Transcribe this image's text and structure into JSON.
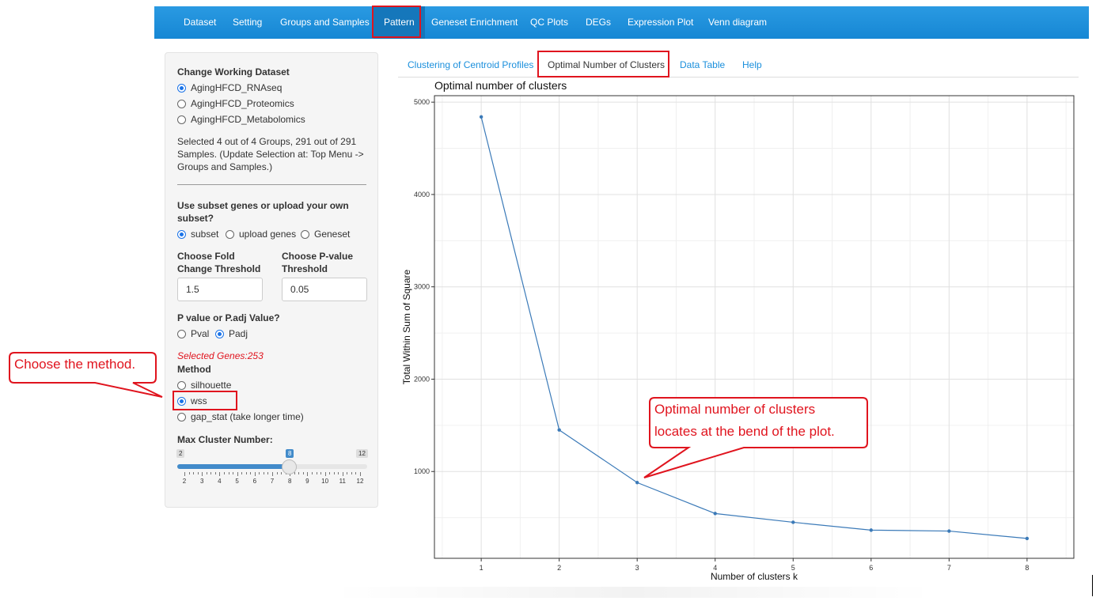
{
  "nav": {
    "items": [
      "Dataset",
      "Setting",
      "Groups and Samples",
      "Pattern",
      "Geneset Enrichment",
      "QC Plots",
      "DEGs",
      "Expression Plot",
      "Venn diagram"
    ],
    "active": "Pattern",
    "bg_color": "#1687d4"
  },
  "sidebar": {
    "dataset_heading": "Change Working Dataset",
    "datasets": [
      "AgingHFCD_RNAseq",
      "AgingHFCD_Proteomics",
      "AgingHFCD_Metabolomics"
    ],
    "dataset_selected": "AgingHFCD_RNAseq",
    "selection_info": [
      "Selected 4 out of 4 Groups, 291 out of 291",
      "Samples. (Update Selection at: Top Menu ->",
      "Groups and Samples.)"
    ],
    "subset_heading": [
      "Use subset genes or upload your own",
      "subset?"
    ],
    "subset_options": [
      "subset",
      "upload genes",
      "Geneset"
    ],
    "subset_selected": "subset",
    "fc_label": [
      "Choose Fold",
      "Change Threshold"
    ],
    "fc_value": "1.5",
    "p_label": [
      "Choose P-value",
      "Threshold"
    ],
    "p_value": "0.05",
    "pval_heading": "P value or P.adj Value?",
    "pval_options": [
      "Pval",
      "Padj"
    ],
    "pval_selected": "Padj",
    "selected_genes": "Selected Genes:253",
    "method_heading": "Method",
    "methods": [
      "silhouette",
      "wss",
      "gap_stat (take longer time)"
    ],
    "method_selected": "wss",
    "max_cluster_heading": "Max Cluster Number:",
    "slider": {
      "min": 2,
      "max": 12,
      "value": 8,
      "min_label": "2",
      "max_label": "12",
      "value_label": "8",
      "tick_labels": [
        "2",
        "3",
        "4",
        "5",
        "6",
        "7",
        "8",
        "9",
        "10",
        "11",
        "12"
      ]
    }
  },
  "tabs": {
    "items": [
      "Clustering of Centroid Profiles",
      "Optimal Number of Clusters",
      "Data Table",
      "Help"
    ],
    "active": "Optimal Number of Clusters"
  },
  "chart_data": {
    "type": "line",
    "title": "Optimal number of clusters",
    "xlabel": "Number of clusters k",
    "ylabel": "Total Within Sum of Square",
    "x": [
      1,
      2,
      3,
      4,
      5,
      6,
      7,
      8
    ],
    "values": [
      4840,
      1450,
      880,
      545,
      450,
      365,
      355,
      275
    ],
    "xlim": [
      0.4,
      8.6
    ],
    "ylim": [
      60,
      5070
    ],
    "y_ticks": [
      1000,
      2000,
      3000,
      4000,
      5000
    ],
    "x_ticks": [
      1,
      2,
      3,
      4,
      5,
      6,
      7,
      8
    ],
    "grid": true,
    "line_color": "#3b7ab8"
  },
  "annotations": {
    "method_callout": "Choose the method.",
    "bend_callout": [
      "Optimal number of clusters",
      "locates at the bend of the plot."
    ],
    "highlight_color": "#e0141e"
  }
}
